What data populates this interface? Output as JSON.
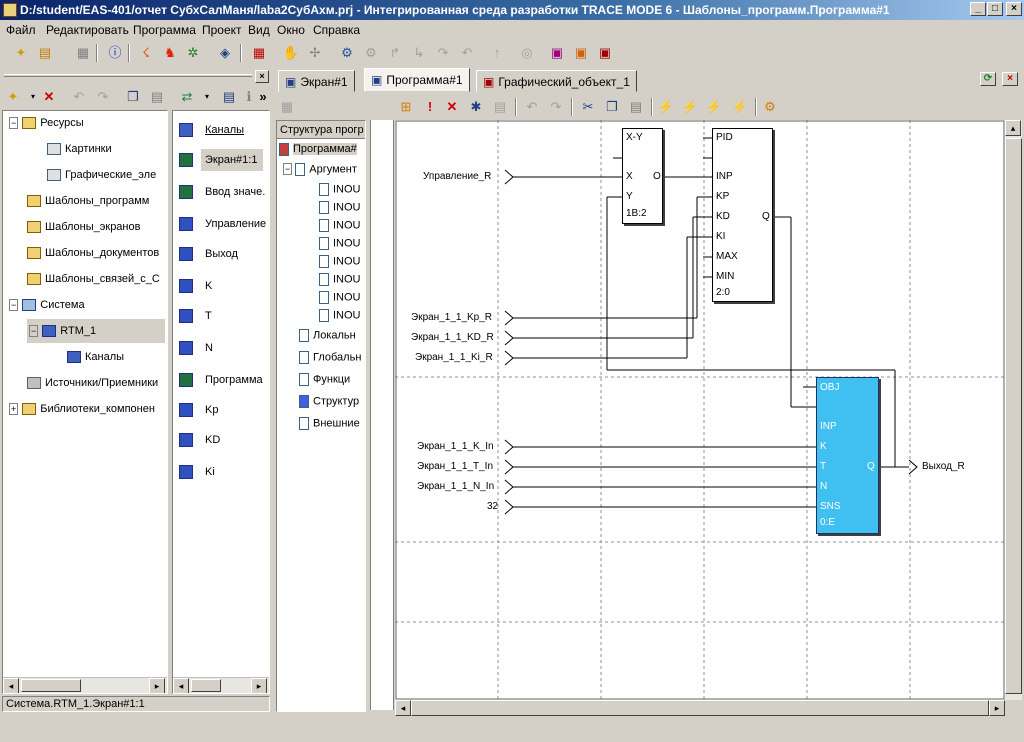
{
  "window": {
    "title": "D:/student/EAS-401/отчет СубхСалМаня/laba2СубАхм.prj - Интегрированная среда разработки TRACE MODE 6 - Шаблоны_программ.Программа#1",
    "minimize": "_",
    "maximize": "□",
    "close": "×"
  },
  "menu": [
    "Файл",
    "Редактировать",
    "Программа",
    "Проект",
    "Вид",
    "Окно",
    "Справка"
  ],
  "navigator": {
    "tree": [
      {
        "label": "Ресурсы",
        "expander": "−"
      },
      {
        "label": "Картинки"
      },
      {
        "label": "Графические_эле"
      },
      {
        "label": "Шаблоны_программ"
      },
      {
        "label": "Шаблоны_экранов"
      },
      {
        "label": "Шаблоны_документов"
      },
      {
        "label": "Шаблоны_связей_с_С"
      },
      {
        "label": "Система",
        "expander": "−"
      },
      {
        "label": "RTM_1",
        "expander": "−"
      },
      {
        "label": "Каналы"
      },
      {
        "label": "Источники/Приемники"
      },
      {
        "label": "Библиотеки_компонен",
        "expander": "+"
      }
    ],
    "status": "Система.RTM_1.Экран#1:1"
  },
  "channels": {
    "header": "Каналы",
    "items": [
      {
        "label": "Экран#1:1",
        "badge": "C"
      },
      {
        "label": "Ввод значе.",
        "badge": "C"
      },
      {
        "label": "Управление",
        "badge": "F"
      },
      {
        "label": "Выход",
        "badge": "F"
      },
      {
        "label": "K",
        "badge": "F"
      },
      {
        "label": "T",
        "badge": "F"
      },
      {
        "label": "N",
        "badge": "F"
      },
      {
        "label": "Программа",
        "badge": "C"
      },
      {
        "label": "Kp",
        "badge": "F"
      },
      {
        "label": "KD",
        "badge": "F"
      },
      {
        "label": "Ki",
        "badge": "F"
      }
    ]
  },
  "tabs": [
    {
      "label": "Экран#1"
    },
    {
      "label": "Программа#1"
    },
    {
      "label": "Графический_объект_1"
    }
  ],
  "structure": {
    "header": "Структура прогр",
    "root": "Программа#",
    "args": "Аргумент",
    "inouts": [
      "INOU",
      "INOU",
      "INOU",
      "INOU",
      "INOU",
      "INOU",
      "INOU",
      "INOU"
    ],
    "others": [
      "Локальн",
      "Глобальн",
      "Функци",
      "Структур",
      "Внешние"
    ]
  },
  "diagram": {
    "inputs": {
      "upr": "Управление_R",
      "kp": "Экран_1_1_Kp_R",
      "kd": "Экран_1_1_KD_R",
      "ki": "Экран_1_1_Ki_R",
      "k": "Экран_1_1_K_In",
      "t": "Экран_1_1_T_In",
      "n": "Экран_1_1_N_In",
      "c32": "32"
    },
    "output": "Выход_R",
    "xy": {
      "title": "X-Y",
      "x": "X",
      "o": "O",
      "y": "Y",
      "foot": "1B:2"
    },
    "pid": {
      "title": "PID",
      "inp": "INP",
      "kp": "KP",
      "kd": "KD",
      "ki": "KI",
      "max": "MAX",
      "min": "MIN",
      "q": "Q",
      "foot": "2:0"
    },
    "obj": {
      "title": "OBJ",
      "inp": "INP",
      "k": "K",
      "t": "T",
      "n": "N",
      "sns": "SNS",
      "q": "Q",
      "foot": "0:E"
    }
  }
}
